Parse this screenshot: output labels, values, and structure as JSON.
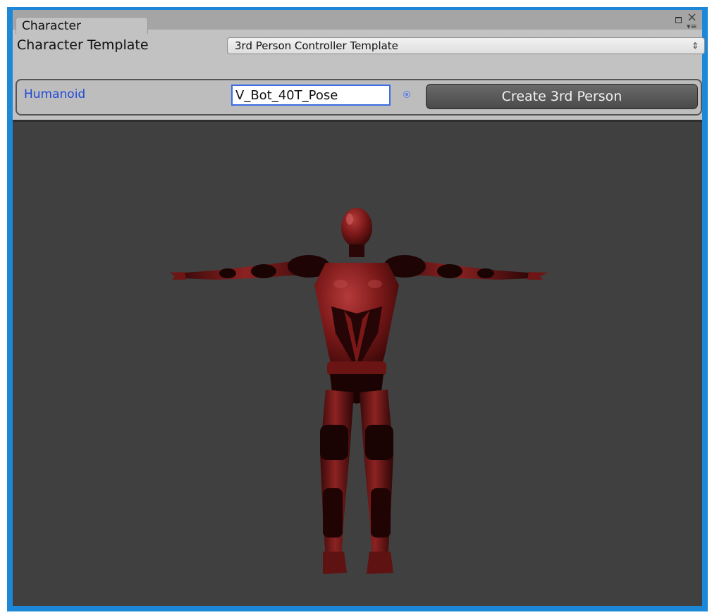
{
  "window": {
    "tab_title": "Character"
  },
  "template_row": {
    "label": "Character Template",
    "dropdown_value": "3rd Person Controller Template"
  },
  "humanoid_row": {
    "label": "Humanoid",
    "input_value": "V_Bot_40T_Pose",
    "create_button_label": "Create 3rd Person"
  },
  "colors": {
    "accent": "#1e88d8",
    "humanoid_label": "#1f49d8",
    "viewport_bg": "#404040",
    "character_red": "#7a1818"
  },
  "icons": {
    "maximize": "maximize-icon",
    "close": "close-icon",
    "menu": "menu-icon",
    "dropdown_arrow": "updown-arrow-icon",
    "object_picker": "target-icon"
  }
}
